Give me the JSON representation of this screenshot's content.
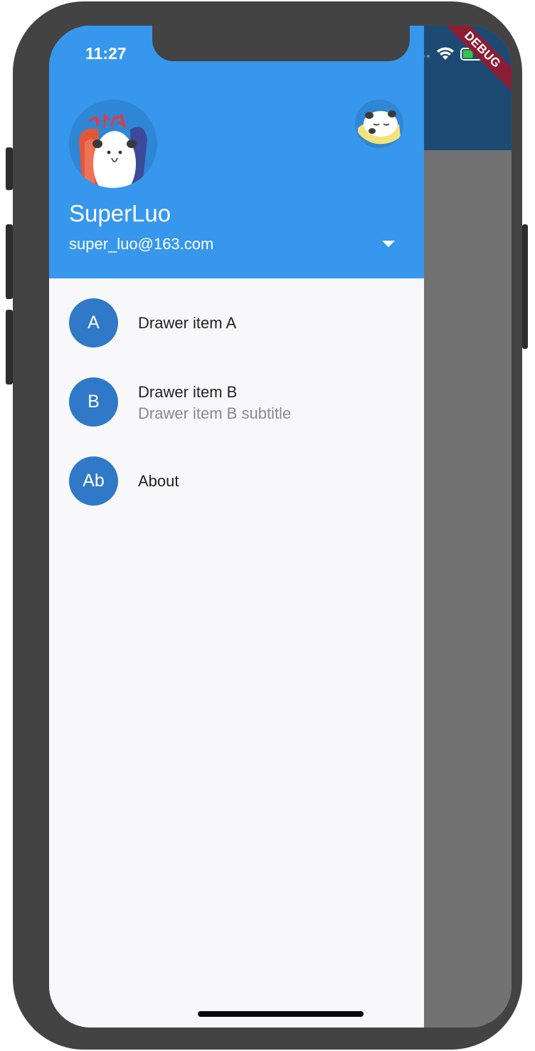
{
  "status_bar": {
    "time": "11:27"
  },
  "debug_banner": "DEBUG",
  "drawer": {
    "header": {
      "account_name": "SuperLuo",
      "account_email": "super_luo@163.com",
      "avatar_text": "加油"
    },
    "items": [
      {
        "avatar": "A",
        "title": "Drawer item A"
      },
      {
        "avatar": "B",
        "title": "Drawer item B",
        "subtitle": "Drawer item B subtitle"
      },
      {
        "avatar": "Ab",
        "title": "About"
      }
    ]
  },
  "colors": {
    "drawer_header": "#3797ec",
    "avatar_circle": "#2f79c8",
    "app_bar": "#1d4a73",
    "scrim": "#727273",
    "debug_banner": "#8b1e34"
  }
}
